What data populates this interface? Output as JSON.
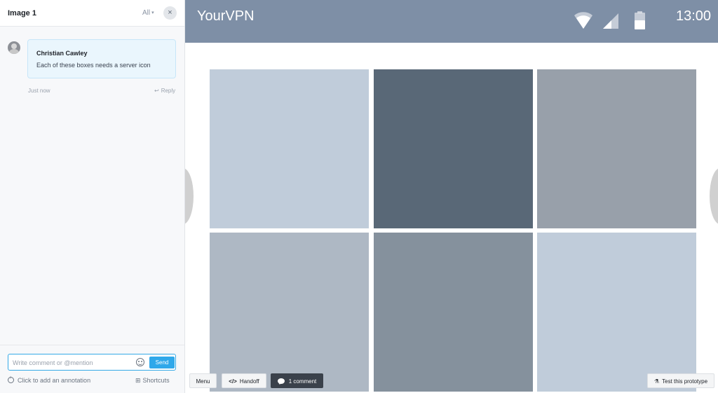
{
  "panel": {
    "title": "Image 1",
    "filter_label": "All",
    "close_icon": "×",
    "comment": {
      "author": "Christian Cawley",
      "text": "Each of these boxes needs a server icon",
      "time": "Just now",
      "reply_label": "Reply"
    },
    "input": {
      "placeholder": "Write comment or @mention",
      "send_label": "Send"
    },
    "annotation_label": "Click to add an annotation",
    "shortcuts_label": "Shortcuts"
  },
  "prototype": {
    "app_title": "YourVPN",
    "time": "13:00",
    "status_icons": [
      "wifi-icon",
      "signal-icon",
      "battery-icon"
    ],
    "tiles": [
      {
        "color": "#c0ccda"
      },
      {
        "color": "#596877"
      },
      {
        "color": "#98a0aa"
      },
      {
        "color": "#aeb8c4"
      },
      {
        "color": "#85919d"
      },
      {
        "color": "#c0ccda"
      }
    ]
  },
  "toolbar": {
    "menu_label": "Menu",
    "handoff_label": "Handoff",
    "comments_label": "1 comment",
    "test_label": "Test this prototype"
  },
  "colors": {
    "accent": "#2fa8ea",
    "statusbar": "#7e8fa6",
    "dark_button": "#3a414b"
  }
}
